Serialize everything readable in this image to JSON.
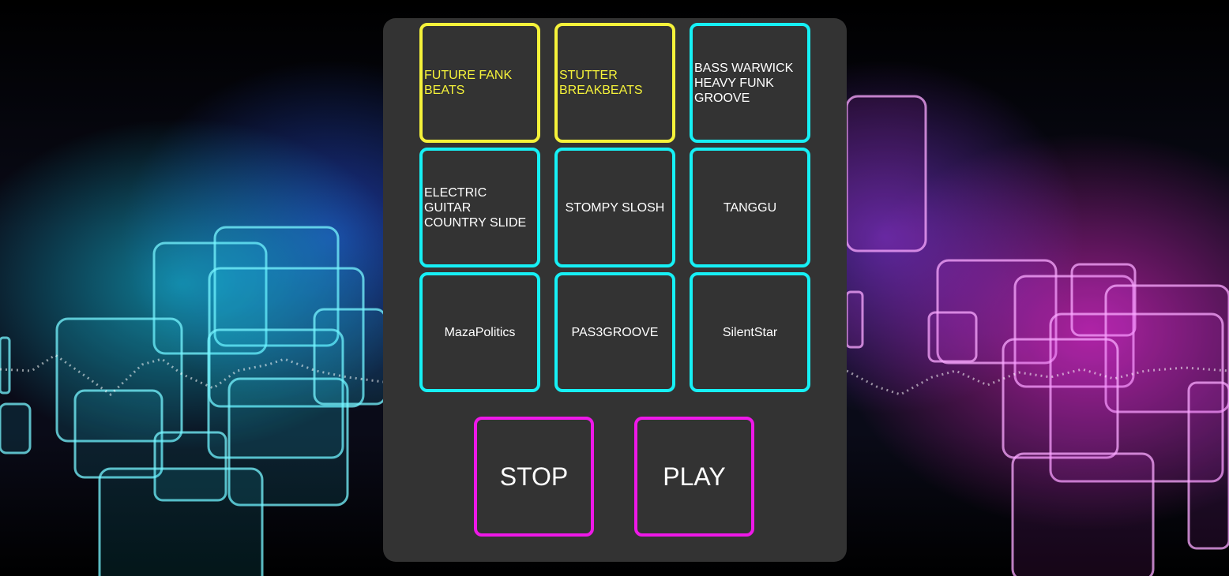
{
  "colors": {
    "panel_bg": "#333333",
    "pad_border": "#16f0f5",
    "pad_active": "#f5f23a",
    "control_border": "#ee18e8",
    "text": "#ffffff"
  },
  "pads": [
    {
      "label": "FUTURE FANK BEATS",
      "active": true
    },
    {
      "label": "STUTTER BREAKBEATS",
      "active": true
    },
    {
      "label": "BASS WARWICK HEAVY FUNK GROOVE",
      "active": false
    },
    {
      "label": "ELECTRIC GUITAR COUNTRY SLIDE",
      "active": false
    },
    {
      "label": "STOMPY SLOSH",
      "active": false
    },
    {
      "label": "TANGGU",
      "active": false
    },
    {
      "label": "MazaPolitics",
      "active": false
    },
    {
      "label": "PAS3GROOVE",
      "active": false
    },
    {
      "label": "SilentStar",
      "active": false
    }
  ],
  "controls": {
    "stop_label": "STOP",
    "play_label": "PLAY"
  }
}
